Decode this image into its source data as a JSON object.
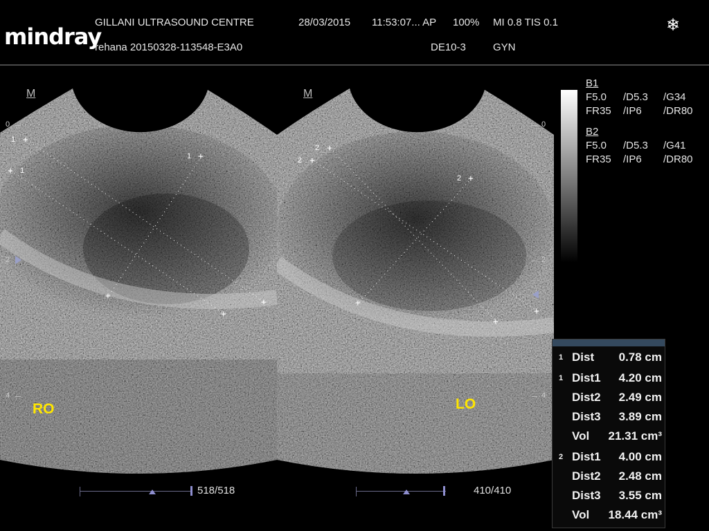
{
  "header": {
    "brand": "mindray",
    "centre": "GILLANI ULTRASOUND CENTRE",
    "date": "28/03/2015",
    "time_ap": "11:53:07... AP",
    "power": "100%",
    "mi_tis": "MI 0.8 TIS 0.1",
    "patient_id": "rehana 20150328-113548-E3A0",
    "probe": "DE10-3",
    "exam": "GYN",
    "freeze_icon": "snowflake-icon"
  },
  "left_image": {
    "marker": "M",
    "label": "RO",
    "scale": [
      "0",
      "2",
      "4"
    ],
    "calipers": [
      "1",
      "1",
      "1"
    ],
    "frame": "518/518"
  },
  "right_image": {
    "marker": "M",
    "label": "LO",
    "scale": [
      "0",
      "2",
      "4"
    ],
    "calipers": [
      "2",
      "2",
      "2"
    ],
    "frame": "410/410"
  },
  "params": {
    "b1": {
      "title": "B1",
      "row1": [
        "F5.0",
        "/D5.3",
        "/G34"
      ],
      "row2": [
        "FR35",
        "/IP6",
        "/DR80"
      ]
    },
    "b2": {
      "title": "B2",
      "row1": [
        "F5.0",
        "/D5.3",
        "/G41"
      ],
      "row2": [
        "FR35",
        "/IP6",
        "/DR80"
      ]
    }
  },
  "measurements": [
    {
      "idx": "1",
      "label": "Dist",
      "value": "0.78 cm"
    },
    {
      "idx": "1",
      "label": "Dist1",
      "value": "4.20 cm"
    },
    {
      "idx": "",
      "label": "Dist2",
      "value": "2.49 cm"
    },
    {
      "idx": "",
      "label": "Dist3",
      "value": "3.89 cm"
    },
    {
      "idx": "",
      "label": "Vol",
      "value": "21.31 cm³"
    },
    {
      "idx": "2",
      "label": "Dist1",
      "value": "4.00 cm"
    },
    {
      "idx": "",
      "label": "Dist2",
      "value": "2.48 cm"
    },
    {
      "idx": "",
      "label": "Dist3",
      "value": "3.55 cm"
    },
    {
      "idx": "",
      "label": "Vol",
      "value": "18.44 cm³"
    }
  ]
}
